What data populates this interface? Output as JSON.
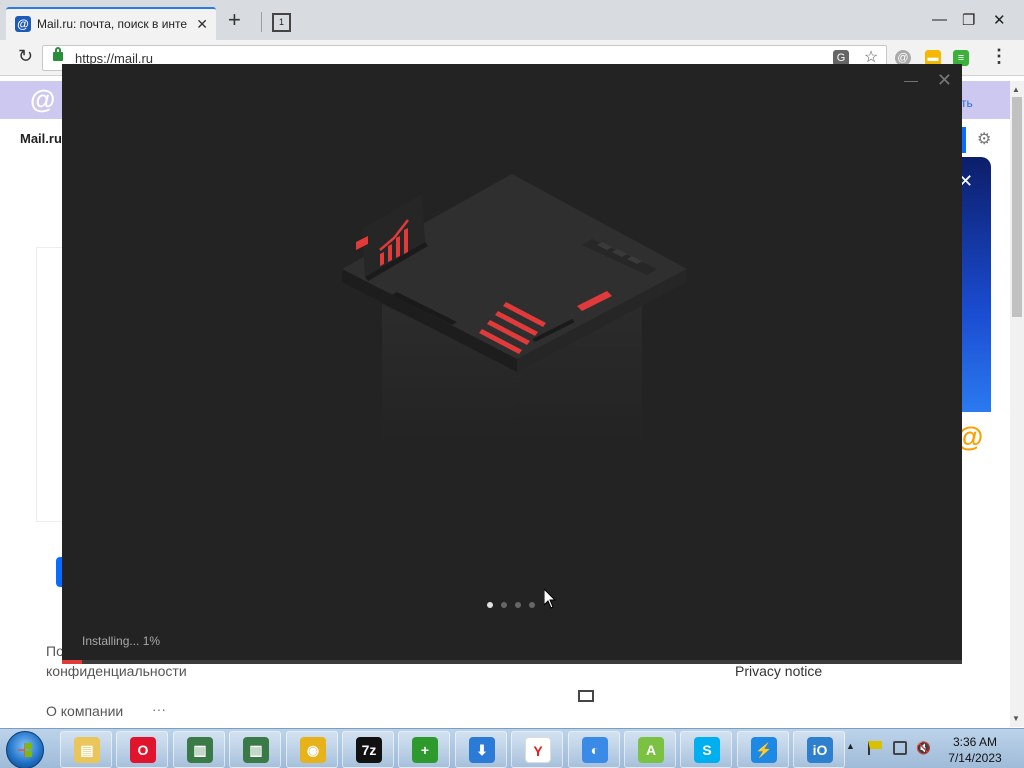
{
  "browser": {
    "tab": {
      "title": "Mail.ru: почта, поиск в инте",
      "close": "✕"
    },
    "new_tab": "+",
    "tab_count": "1",
    "window": {
      "minimize": "—",
      "restore": "❐",
      "close": "✕"
    },
    "address": {
      "url": "https://mail.ru"
    },
    "menu": "⋮"
  },
  "page": {
    "header_logo": "@",
    "login_link": "реть",
    "brand": "Mail.ru",
    "footer_link_1": "По",
    "footer_link_2": "конфиденциальности",
    "about": "О компании",
    "more": "···",
    "privacy_notice": "Privacy notice",
    "promo_close": "✕",
    "at_logo": "@"
  },
  "installer": {
    "minimize": "—",
    "close": "✕",
    "status": "Installing... 1%",
    "progress": 1,
    "slides": {
      "count": 4,
      "active": 0
    },
    "colors": {
      "background": "#232323",
      "accent": "#e03a3a"
    }
  },
  "taskbar": {
    "apps": [
      {
        "name": "file-explorer-icon",
        "color": "#e9c55a",
        "glyph": "▤"
      },
      {
        "name": "opera-icon",
        "color": "#e0142c",
        "glyph": "O"
      },
      {
        "name": "window-app-icon",
        "color": "#3a7a46",
        "glyph": "▥"
      },
      {
        "name": "window-app-icon-2",
        "color": "#3a7a46",
        "glyph": "▥"
      },
      {
        "name": "chrome-icon",
        "color": "#e8b21a",
        "glyph": "◉"
      },
      {
        "name": "7zip-icon",
        "color": "#111111",
        "glyph": "7z"
      },
      {
        "name": "add-app-icon",
        "color": "#2e9a2e",
        "glyph": "+"
      },
      {
        "name": "download-icon",
        "color": "#2b7bd6",
        "glyph": "⬇"
      },
      {
        "name": "yandex-icon",
        "color": "#ffffff",
        "glyph": "Y"
      },
      {
        "name": "browser-icon",
        "color": "#3a8be8",
        "glyph": "◐"
      },
      {
        "name": "android-icon",
        "color": "#7cc242",
        "glyph": "A"
      },
      {
        "name": "skype-icon",
        "color": "#00aff0",
        "glyph": "S"
      },
      {
        "name": "bolt-icon",
        "color": "#1e88e5",
        "glyph": "⚡"
      },
      {
        "name": "iobit-icon",
        "color": "#2f7fcf",
        "glyph": "iO"
      }
    ],
    "tray_arrow": "▲",
    "clock": {
      "time": "3:36 AM",
      "date": "7/14/2023"
    }
  }
}
